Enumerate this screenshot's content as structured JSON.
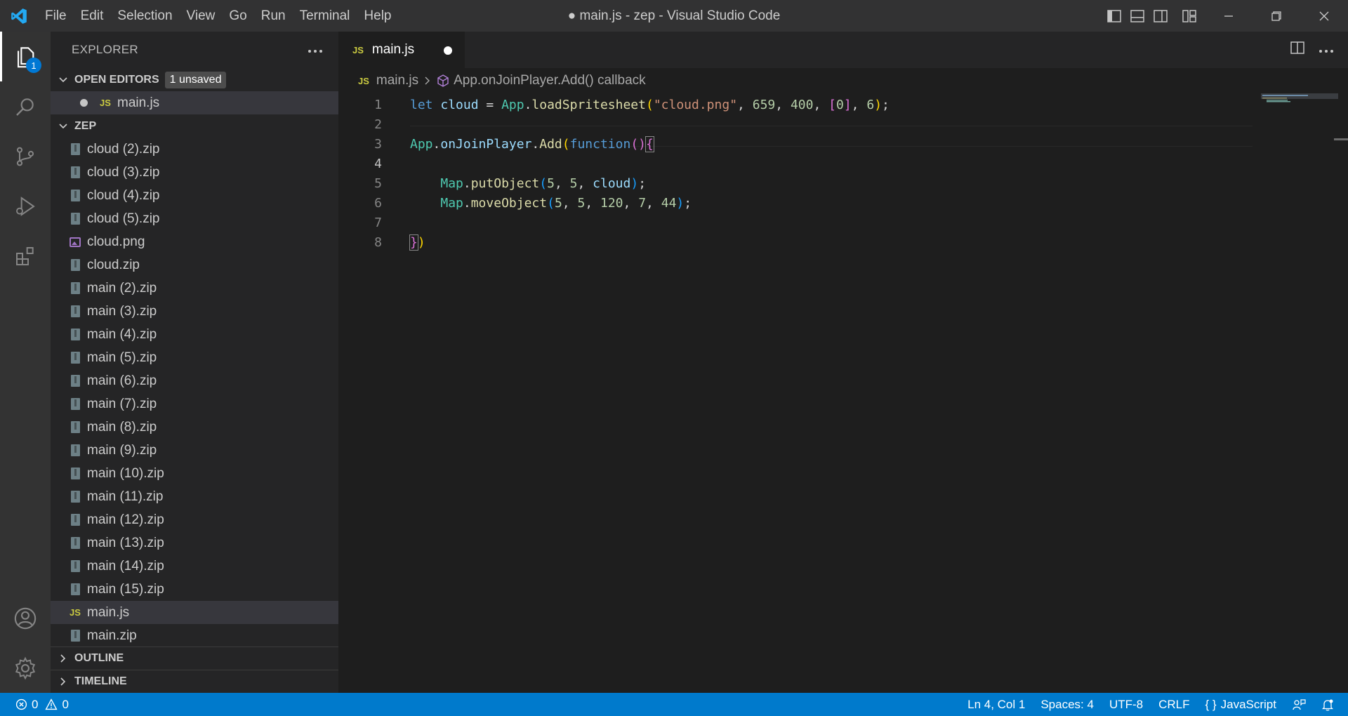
{
  "titlebar": {
    "menu": [
      "File",
      "Edit",
      "Selection",
      "View",
      "Go",
      "Run",
      "Terminal",
      "Help"
    ],
    "window_title": "● main.js - zep - Visual Studio Code"
  },
  "activitybar": {
    "explorer_badge": "1"
  },
  "sidebar": {
    "title": "EXPLORER",
    "open_editors": {
      "label": "OPEN EDITORS",
      "badge": "1 unsaved",
      "files": [
        {
          "name": "main.js",
          "icon": "js"
        }
      ]
    },
    "folder": {
      "label": "ZEP",
      "files": [
        {
          "name": "cloud (2).zip",
          "icon": "zip"
        },
        {
          "name": "cloud (3).zip",
          "icon": "zip"
        },
        {
          "name": "cloud (4).zip",
          "icon": "zip"
        },
        {
          "name": "cloud (5).zip",
          "icon": "zip"
        },
        {
          "name": "cloud.png",
          "icon": "png"
        },
        {
          "name": "cloud.zip",
          "icon": "zip"
        },
        {
          "name": "main (2).zip",
          "icon": "zip"
        },
        {
          "name": "main (3).zip",
          "icon": "zip"
        },
        {
          "name": "main (4).zip",
          "icon": "zip"
        },
        {
          "name": "main (5).zip",
          "icon": "zip"
        },
        {
          "name": "main (6).zip",
          "icon": "zip"
        },
        {
          "name": "main (7).zip",
          "icon": "zip"
        },
        {
          "name": "main (8).zip",
          "icon": "zip"
        },
        {
          "name": "main (9).zip",
          "icon": "zip"
        },
        {
          "name": "main (10).zip",
          "icon": "zip"
        },
        {
          "name": "main (11).zip",
          "icon": "zip"
        },
        {
          "name": "main (12).zip",
          "icon": "zip"
        },
        {
          "name": "main (13).zip",
          "icon": "zip"
        },
        {
          "name": "main (14).zip",
          "icon": "zip"
        },
        {
          "name": "main (15).zip",
          "icon": "zip"
        },
        {
          "name": "main.js",
          "icon": "js",
          "selected": true
        },
        {
          "name": "main.zip",
          "icon": "zip"
        }
      ]
    },
    "outline_label": "OUTLINE",
    "timeline_label": "TIMELINE"
  },
  "editor": {
    "tab": {
      "icon_text": "JS",
      "label": "main.js"
    },
    "breadcrumb": {
      "file": "main.js",
      "symbol": "App.onJoinPlayer.Add() callback"
    },
    "current_line": 4,
    "lines": [
      {
        "n": "1",
        "tokens": [
          [
            "kw",
            "let"
          ],
          [
            "p",
            " "
          ],
          [
            "var",
            "cloud"
          ],
          [
            "p",
            " = "
          ],
          [
            "cls",
            "App"
          ],
          [
            "p",
            "."
          ],
          [
            "fn",
            "loadSpritesheet"
          ],
          [
            "br1",
            "("
          ],
          [
            "str",
            "\"cloud.png\""
          ],
          [
            "p",
            ", "
          ],
          [
            "num",
            "659"
          ],
          [
            "p",
            ", "
          ],
          [
            "num",
            "400"
          ],
          [
            "p",
            ", "
          ],
          [
            "br2",
            "["
          ],
          [
            "num",
            "0"
          ],
          [
            "br2",
            "]"
          ],
          [
            "p",
            ", "
          ],
          [
            "num",
            "6"
          ],
          [
            "br1",
            ")"
          ],
          [
            "p",
            ";"
          ]
        ]
      },
      {
        "n": "2",
        "tokens": []
      },
      {
        "n": "3",
        "tokens": [
          [
            "cls",
            "App"
          ],
          [
            "p",
            "."
          ],
          [
            "var",
            "onJoinPlayer"
          ],
          [
            "p",
            "."
          ],
          [
            "fn",
            "Add"
          ],
          [
            "br1",
            "("
          ],
          [
            "kw",
            "function"
          ],
          [
            "br2",
            "()"
          ],
          [
            "br2b",
            "{"
          ]
        ]
      },
      {
        "n": "4",
        "tokens": []
      },
      {
        "n": "5",
        "tokens": [
          [
            "p",
            "    "
          ],
          [
            "cls",
            "Map"
          ],
          [
            "p",
            "."
          ],
          [
            "fn",
            "putObject"
          ],
          [
            "br3",
            "("
          ],
          [
            "num",
            "5"
          ],
          [
            "p",
            ", "
          ],
          [
            "num",
            "5"
          ],
          [
            "p",
            ", "
          ],
          [
            "var",
            "cloud"
          ],
          [
            "br3",
            ")"
          ],
          [
            "p",
            ";"
          ]
        ]
      },
      {
        "n": "6",
        "tokens": [
          [
            "p",
            "    "
          ],
          [
            "cls",
            "Map"
          ],
          [
            "p",
            "."
          ],
          [
            "fn",
            "moveObject"
          ],
          [
            "br3",
            "("
          ],
          [
            "num",
            "5"
          ],
          [
            "p",
            ", "
          ],
          [
            "num",
            "5"
          ],
          [
            "p",
            ", "
          ],
          [
            "num",
            "120"
          ],
          [
            "p",
            ", "
          ],
          [
            "num",
            "7"
          ],
          [
            "p",
            ", "
          ],
          [
            "num",
            "44"
          ],
          [
            "br3",
            ")"
          ],
          [
            "p",
            ";"
          ]
        ]
      },
      {
        "n": "7",
        "tokens": []
      },
      {
        "n": "8",
        "tokens": [
          [
            "br2b",
            "}"
          ],
          [
            "br1",
            ")"
          ]
        ]
      }
    ]
  },
  "statusbar": {
    "errors": "0",
    "warnings": "0",
    "position": "Ln 4, Col 1",
    "spaces": "Spaces: 4",
    "encoding": "UTF-8",
    "eol": "CRLF",
    "language": "JavaScript",
    "language_prefix": "{ }"
  },
  "colors": {
    "accent": "#007acc",
    "js": "#cbcb41"
  }
}
